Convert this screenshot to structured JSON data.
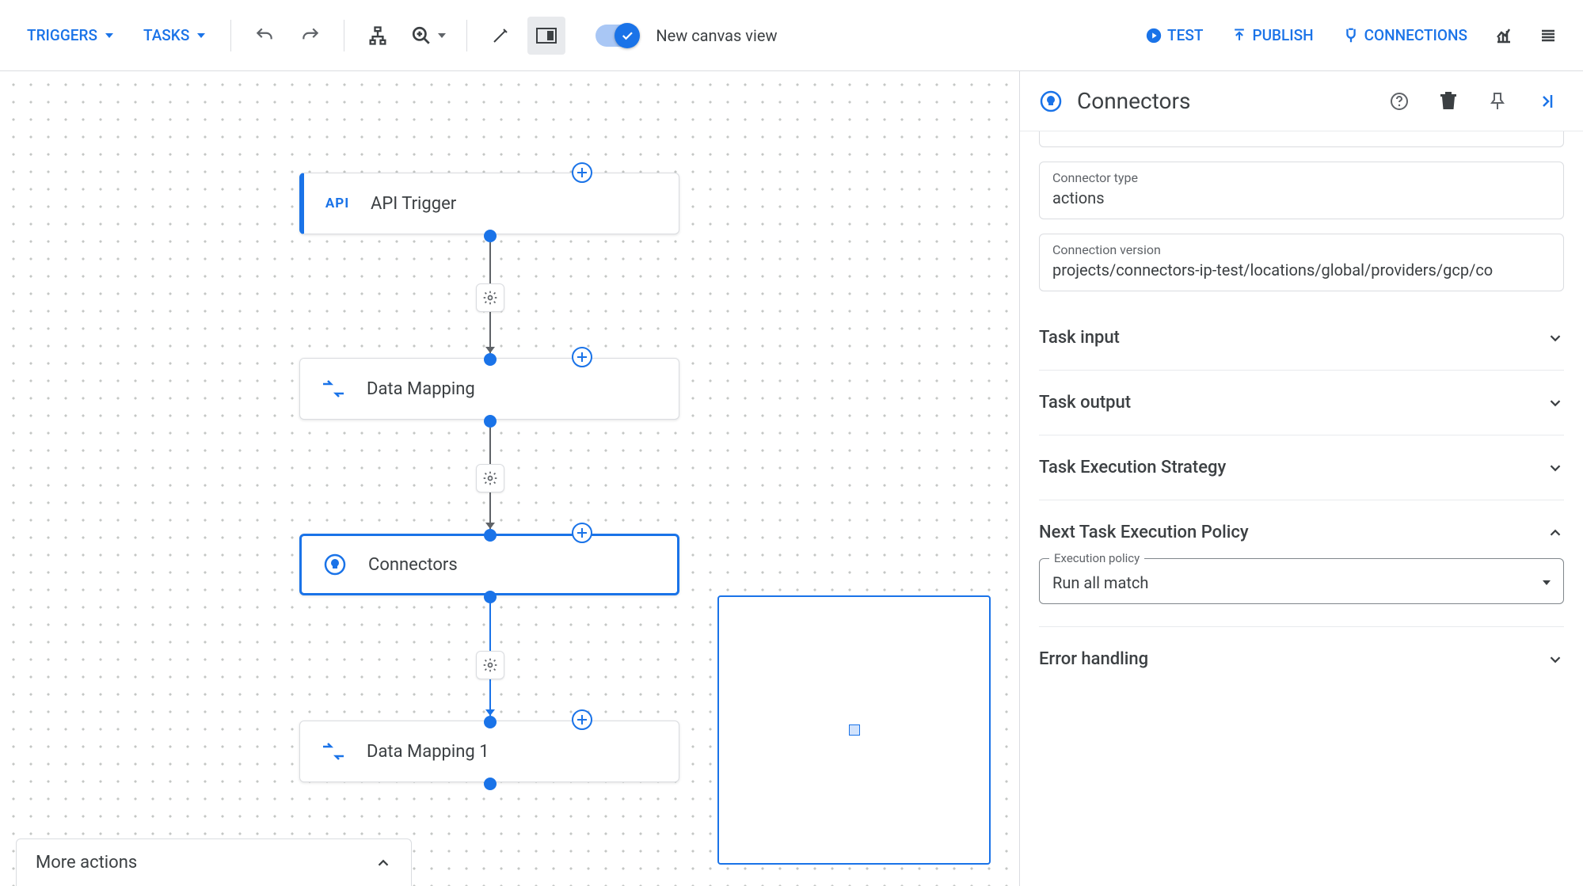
{
  "toolbar": {
    "triggers_label": "TRIGGERS",
    "tasks_label": "TASKS",
    "canvas_toggle_label": "New canvas view",
    "test_label": "TEST",
    "publish_label": "PUBLISH",
    "connections_label": "CONNECTIONS"
  },
  "canvas": {
    "nodes": [
      {
        "label": "API Trigger",
        "icon": "API"
      },
      {
        "label": "Data Mapping",
        "icon": "mapping"
      },
      {
        "label": "Connectors",
        "icon": "connector"
      },
      {
        "label": "Data Mapping 1",
        "icon": "mapping"
      }
    ],
    "more_actions_label": "More actions"
  },
  "panel": {
    "title": "Connectors",
    "fields": {
      "connector_type": {
        "label": "Connector type",
        "value": "actions"
      },
      "connection_version": {
        "label": "Connection version",
        "value": "projects/connectors-ip-test/locations/global/providers/gcp/co"
      }
    },
    "sections": {
      "task_input": "Task input",
      "task_output": "Task output",
      "exec_strategy": "Task Execution Strategy",
      "next_policy": "Next Task Execution Policy",
      "error_handling": "Error handling"
    },
    "execution_policy": {
      "label": "Execution policy",
      "value": "Run all match"
    }
  }
}
